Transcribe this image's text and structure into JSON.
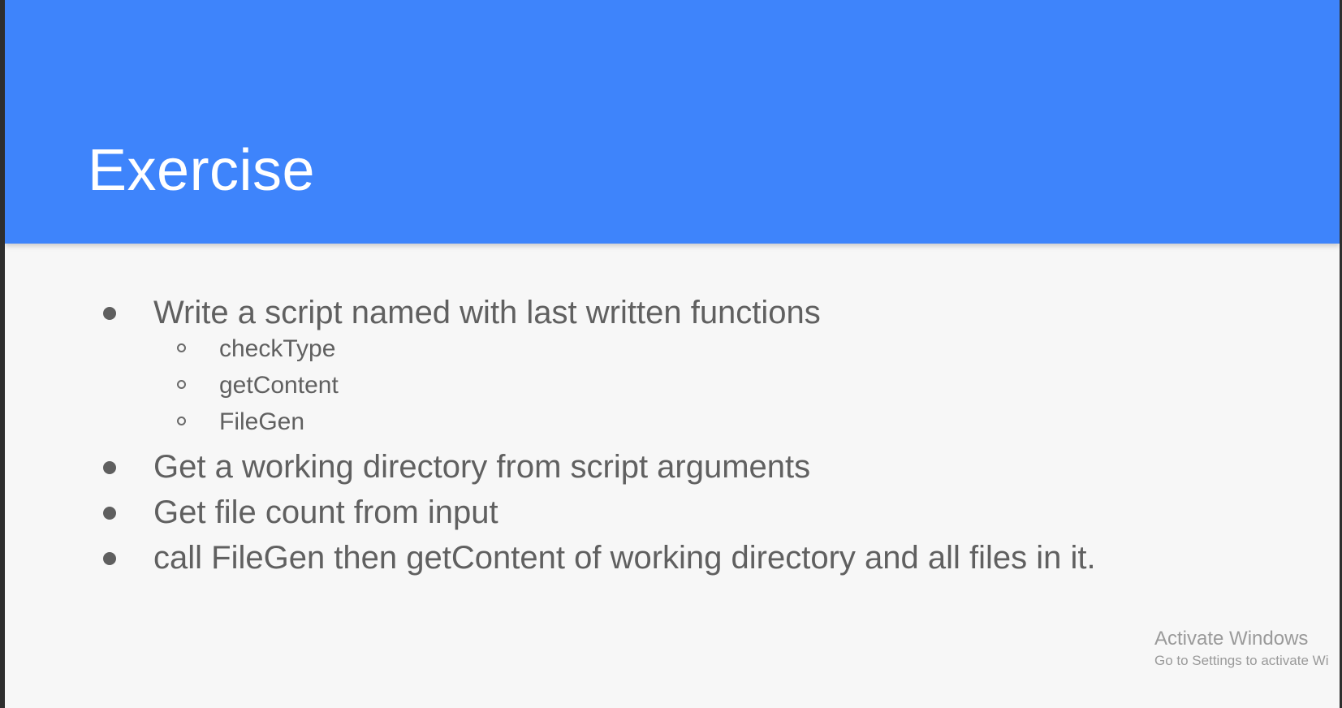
{
  "slide": {
    "title": "Exercise",
    "bullets": [
      {
        "text": "Write a script named with last written functions",
        "sub": [
          "checkType",
          "getContent",
          "FileGen"
        ]
      },
      {
        "text": "Get a working directory from script arguments"
      },
      {
        "text": "Get file count from input"
      },
      {
        "text": "call FileGen then getContent of working directory and all files in it."
      }
    ]
  },
  "watermark": {
    "title": "Activate Windows",
    "subtitle": "Go to Settings to activate Wi"
  },
  "colors": {
    "header": "#3e84fb",
    "background": "#f7f7f7",
    "text": "#606060"
  },
  "icons": [
    "bullet-dot-icon",
    "sub-bullet-circle-icon"
  ]
}
